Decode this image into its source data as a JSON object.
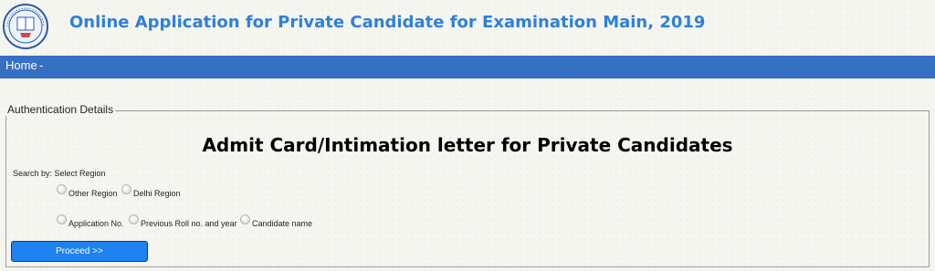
{
  "header": {
    "title": "Online Application for Private Candidate for Examination Main, 2019",
    "logo_icon": "cbse-emblem-icon"
  },
  "nav": {
    "home_label": "Home",
    "separator": "-"
  },
  "form": {
    "legend": "Authentication Details",
    "heading": "Admit Card/Intimation letter for Private Candidates",
    "search_label": "Search by: Select Region",
    "region_options": [
      "Other Region",
      "Delhi Region"
    ],
    "search_type_options": [
      "Application No.",
      "Previous Roll no. and year",
      "Candidate name"
    ],
    "proceed_label": "Proceed >>"
  },
  "colors": {
    "title": "#2f80d8",
    "navbar": "#3570c4",
    "button": "#1e82f0"
  }
}
